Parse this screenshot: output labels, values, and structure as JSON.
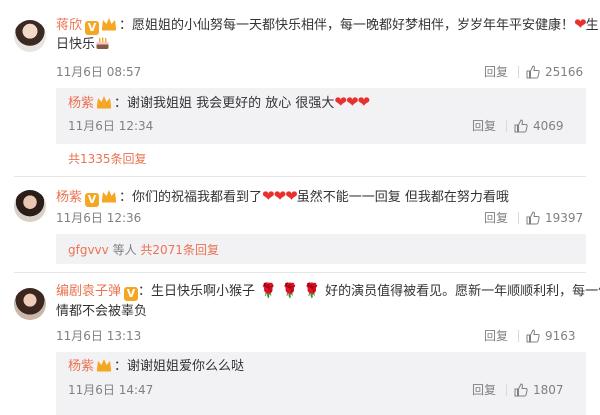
{
  "comments": [
    {
      "user": "蒋欣",
      "text_line1": "：愿姐姐的小仙努每一天都快乐相伴，每一晚都好梦相伴，岁岁年年平安健康！",
      "text_line2": "日快乐",
      "text_line1_tail": "生",
      "date": "11月6日 08:57",
      "reply_label": "回复",
      "likes": "25166",
      "sub_reply": {
        "user": "杨紫",
        "text": "：谢谢我姐姐 我会更好的 放心 很强大",
        "date": "11月6日 12:34",
        "reply_label": "回复",
        "likes": "4069"
      },
      "more_text": "共1335条回复"
    },
    {
      "user": "杨紫",
      "text_line1": "：你们的祝福我都看到了",
      "text_line1_tail": "虽然不能一一回复 但我都在努力看哦",
      "date": "11月6日 12:36",
      "reply_label": "回复",
      "likes": "19397",
      "more_user": "gfgvvv",
      "more_mid": " 等人 ",
      "more_text": "共2071条回复"
    },
    {
      "user": "编剧袁子弹",
      "text_line1": "：生日快乐啊小猴子",
      "text_line1_tail": "好的演员值得被看见。愿新一年顺顺利利，每一份热",
      "text_line2": "情都不会被辜负",
      "date": "11月6日 13:13",
      "reply_label": "回复",
      "likes": "9163",
      "sub_reply": {
        "user": "杨紫",
        "text": "：谢谢姐姐爱你么么哒",
        "date": "11月6日 14:47",
        "reply_label": "回复",
        "likes": "1807"
      }
    }
  ],
  "icons": {
    "like": "thumbs-up-icon",
    "vip": "v-badge-icon",
    "crown": "crown-icon",
    "heart": "heart-icon",
    "rose": "rose-icon",
    "cake": "cake-icon"
  },
  "colors": {
    "accent": "#eb7350",
    "meta": "#808080",
    "reply_bg": "#f2f2f5",
    "heart": "#e8312f"
  }
}
